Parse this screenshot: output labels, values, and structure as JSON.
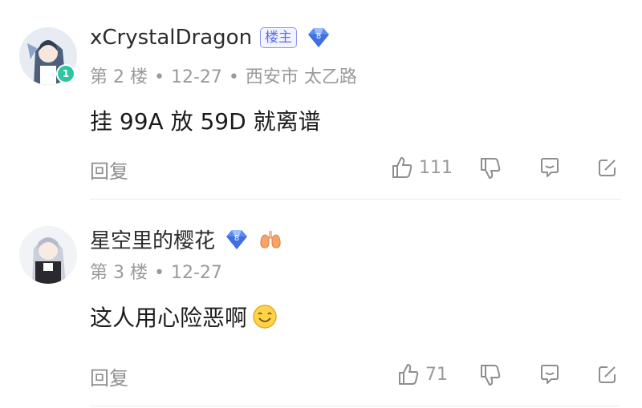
{
  "comments": [
    {
      "username": "xCrystalDragon",
      "op_badge": "楼主",
      "gem_level": "8",
      "avatar_level": "1",
      "floor": "第 2 楼",
      "date": "12-27",
      "location": "西安市 太乙路",
      "content": "挂 99A 放 59D 就离谱",
      "reply_label": "回复",
      "like_count": "111"
    },
    {
      "username": "星空里的樱花",
      "gem_level": "8",
      "floor": "第 3 楼",
      "date": "12-27",
      "content": "这人用心险恶啊",
      "reply_label": "回复",
      "like_count": "71"
    }
  ],
  "colors": {
    "accent": "#5b6ee8",
    "gem": "#4a7cf0",
    "level_badge": "#2fc5a2",
    "muted_text": "#9a9a9a"
  },
  "icons": [
    "thumbs-up-icon",
    "thumbs-down-icon",
    "comment-icon",
    "share-icon",
    "diamond-gem-icon",
    "lungs-badge-icon",
    "smile-emoji-icon"
  ]
}
